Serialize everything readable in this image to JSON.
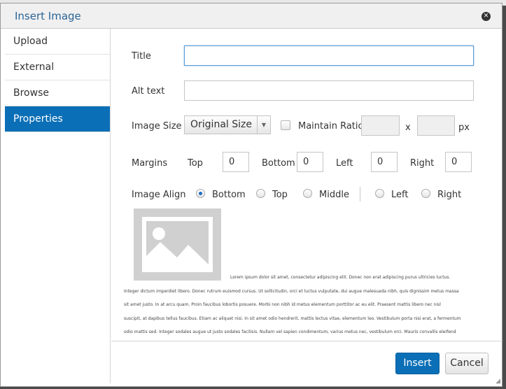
{
  "dialog": {
    "title": "Insert Image",
    "close_icon": "close-icon"
  },
  "sidebar": {
    "items": [
      {
        "label": "Upload"
      },
      {
        "label": "External"
      },
      {
        "label": "Browse"
      },
      {
        "label": "Properties",
        "active": true
      }
    ]
  },
  "properties": {
    "title_label": "Title",
    "title_value": "",
    "alt_label": "Alt text",
    "alt_value": "",
    "size_label": "Image Size",
    "size_selected": "Original Size",
    "maintain_ratio_label": "Maintain Ratio",
    "maintain_ratio_checked": false,
    "width_value": "",
    "height_value": "",
    "x_label": "x",
    "px_label": "px",
    "margins_label": "Margins",
    "margin_top_label": "Top",
    "margin_top_value": "0",
    "margin_bottom_label": "Bottom",
    "margin_bottom_value": "0",
    "margin_left_label": "Left",
    "margin_left_value": "0",
    "margin_right_label": "Right",
    "margin_right_value": "0",
    "align_label": "Image Align",
    "align_options": {
      "bottom": "Bottom",
      "top": "Top",
      "middle": "Middle",
      "left": "Left",
      "right": "Right"
    },
    "align_selected": "Bottom"
  },
  "preview": {
    "line1": "Lorem ipsum dolor sit amet, consectetur adipiscing elit. Donec non erat adipiscing purus ultricies luctus.",
    "line2": "Integer dictum imperdiet libero. Donec rutrum euismod cursus. Ut sollicitudin, orci et luctus vulputate, dui augue malesuada nibh, quis dignissim metus massa",
    "line3": "sit amet justo. In at arcu quam. Proin faucibus lobortis posuere. Morbi non nibh id metus elementum porttitor ac eu elit. Praesent mattis libero nec nisl",
    "line4": "suscipit, at dapibus tellus faucibus. Etiam ac aliquet nisi. In sit amet odio hendrerit, mattis lectus vitae, elementum leo. Vestibulum porta nisi erat, a fermentum",
    "line5": "odio mattis sed. Integer sodales augue ut justo sodales facilisis. Nullam vel sapien condimentum, varius metus nec, vestibulum orci. Mauris convallis eleifend"
  },
  "footer": {
    "insert_label": "Insert",
    "cancel_label": "Cancel"
  }
}
